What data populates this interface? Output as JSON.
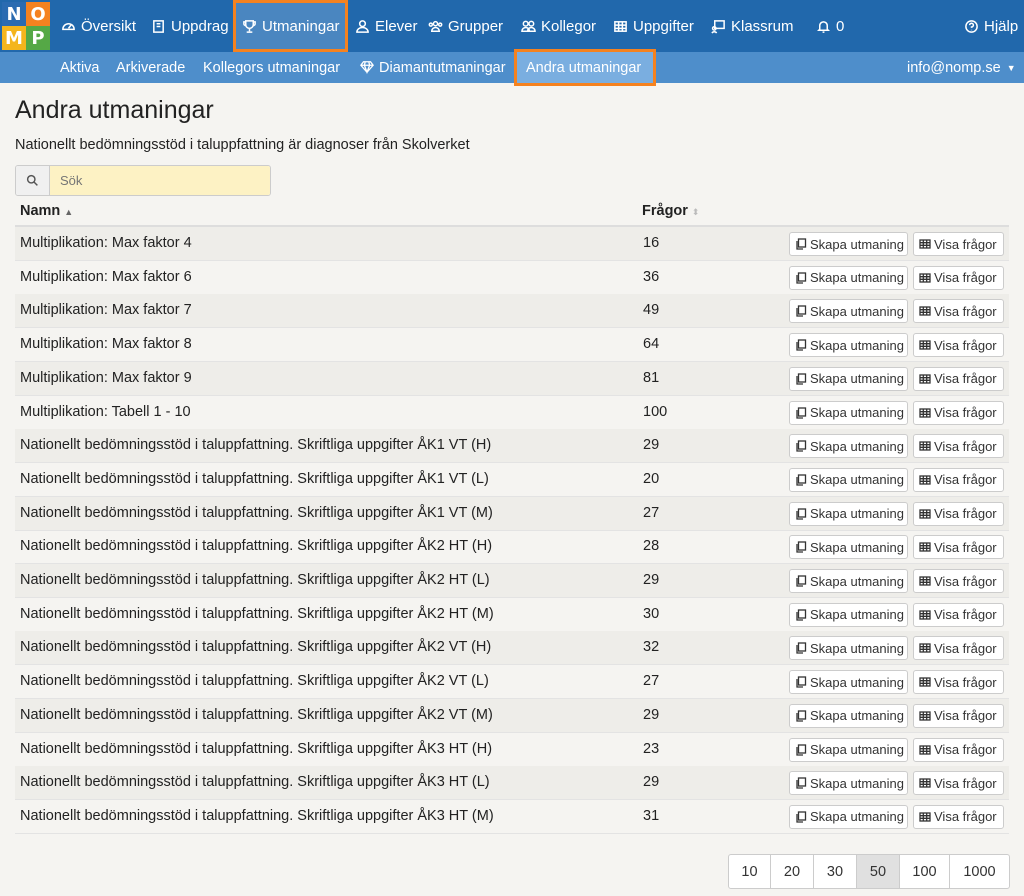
{
  "logo": {
    "letters": [
      "N",
      "O",
      "M",
      "P"
    ],
    "colors": [
      "#2a6bb1",
      "#f58220",
      "#f4b51d",
      "#55a846"
    ]
  },
  "nav": {
    "items": [
      {
        "label": "Översikt",
        "icon": "dashboard-icon"
      },
      {
        "label": "Uppdrag",
        "icon": "book-icon"
      },
      {
        "label": "Utmaningar",
        "icon": "trophy-icon"
      },
      {
        "label": "Elever",
        "icon": "user-icon"
      },
      {
        "label": "Grupper",
        "icon": "users-icon"
      },
      {
        "label": "Kollegor",
        "icon": "colleagues-icon"
      },
      {
        "label": "Uppgifter",
        "icon": "table-icon"
      },
      {
        "label": "Klassrum",
        "icon": "classroom-icon"
      },
      {
        "label": "0",
        "icon": "bell-icon"
      },
      {
        "label": "Hjälp",
        "icon": "help-icon"
      }
    ],
    "active": "Utmaningar"
  },
  "subnav": {
    "items": [
      "Aktiva",
      "Arkiverade",
      "Kollegors utmaningar",
      "Diamantutmaningar",
      "Andra utmaningar"
    ],
    "active": "Andra utmaningar",
    "account": "info@nomp.se"
  },
  "page": {
    "title": "Andra utmaningar",
    "description": "Nationellt bedömningsstöd i taluppfattning är diagnoser från Skolverket",
    "search_placeholder": "Sök"
  },
  "table": {
    "headers": {
      "name": "Namn",
      "questions": "Frågor"
    },
    "create_label": "Skapa utmaning",
    "view_label": "Visa frågor",
    "rows": [
      {
        "name": "Multiplikation: Max faktor 4",
        "questions": "16"
      },
      {
        "name": "Multiplikation: Max faktor 6",
        "questions": "36"
      },
      {
        "name": "Multiplikation: Max faktor 7",
        "questions": "49"
      },
      {
        "name": "Multiplikation: Max faktor 8",
        "questions": "64"
      },
      {
        "name": "Multiplikation: Max faktor 9",
        "questions": "81"
      },
      {
        "name": "Multiplikation: Tabell 1 - 10",
        "questions": "100"
      },
      {
        "name": "Nationellt bedömningsstöd i taluppfattning. Skriftliga uppgifter ÅK1 VT (H)",
        "questions": "29"
      },
      {
        "name": "Nationellt bedömningsstöd i taluppfattning. Skriftliga uppgifter ÅK1 VT (L)",
        "questions": "20"
      },
      {
        "name": "Nationellt bedömningsstöd i taluppfattning. Skriftliga uppgifter ÅK1 VT (M)",
        "questions": "27"
      },
      {
        "name": "Nationellt bedömningsstöd i taluppfattning. Skriftliga uppgifter ÅK2 HT (H)",
        "questions": "28"
      },
      {
        "name": "Nationellt bedömningsstöd i taluppfattning. Skriftliga uppgifter ÅK2 HT (L)",
        "questions": "29"
      },
      {
        "name": "Nationellt bedömningsstöd i taluppfattning. Skriftliga uppgifter ÅK2 HT (M)",
        "questions": "30"
      },
      {
        "name": "Nationellt bedömningsstöd i taluppfattning. Skriftliga uppgifter ÅK2 VT (H)",
        "questions": "32"
      },
      {
        "name": "Nationellt bedömningsstöd i taluppfattning. Skriftliga uppgifter ÅK2 VT (L)",
        "questions": "27"
      },
      {
        "name": "Nationellt bedömningsstöd i taluppfattning. Skriftliga uppgifter ÅK2 VT (M)",
        "questions": "29"
      },
      {
        "name": "Nationellt bedömningsstöd i taluppfattning. Skriftliga uppgifter ÅK3 HT (H)",
        "questions": "23"
      },
      {
        "name": "Nationellt bedömningsstöd i taluppfattning. Skriftliga uppgifter ÅK3 HT (L)",
        "questions": "29"
      },
      {
        "name": "Nationellt bedömningsstöd i taluppfattning. Skriftliga uppgifter ÅK3 HT (M)",
        "questions": "31"
      }
    ]
  },
  "pagination": {
    "sizes": [
      "10",
      "20",
      "30",
      "50",
      "100",
      "1000"
    ],
    "active": "50"
  }
}
